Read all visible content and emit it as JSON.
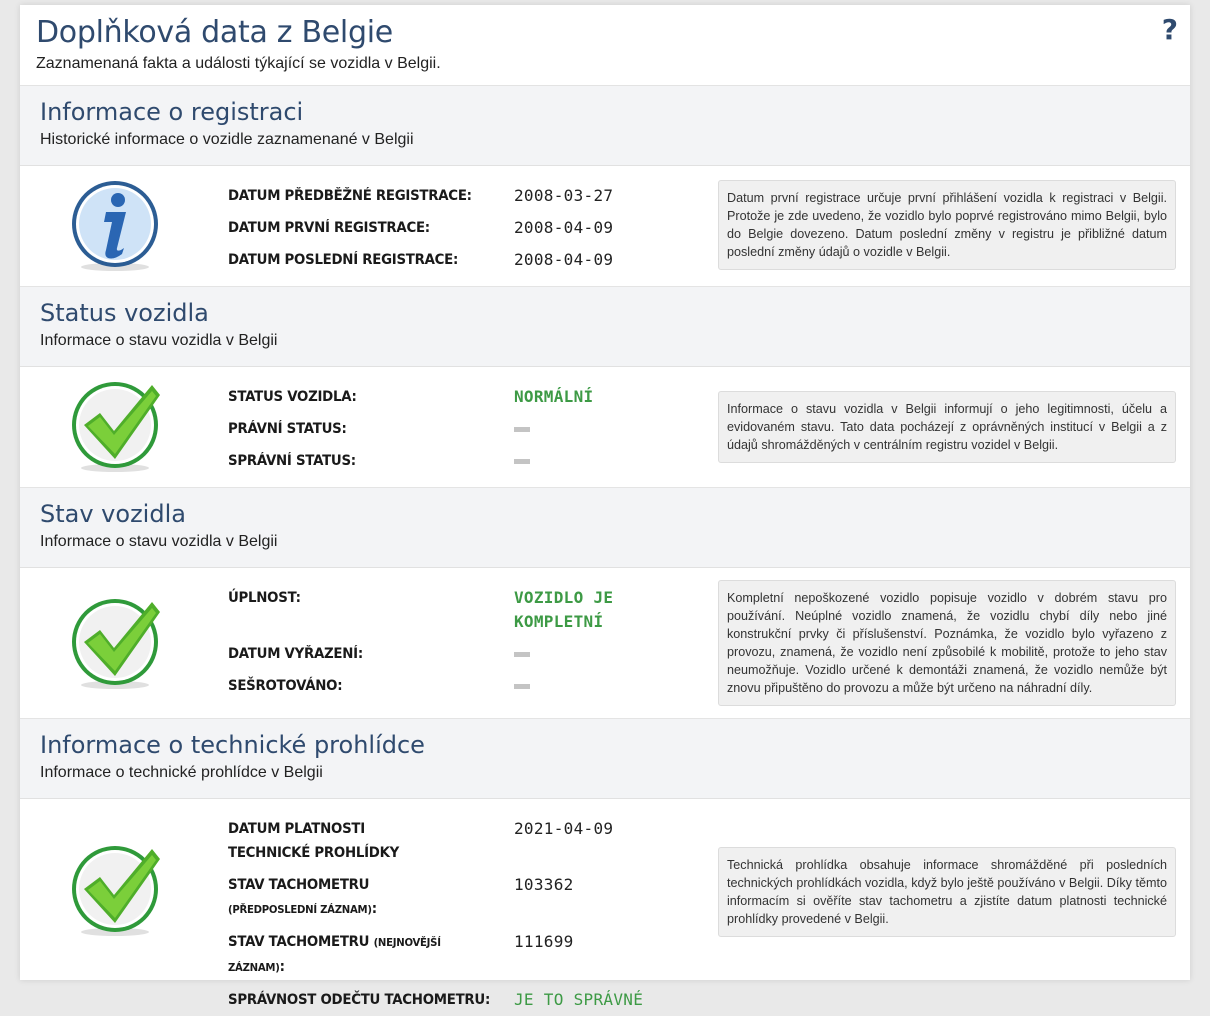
{
  "header": {
    "title": "Doplňková data z Belgie",
    "subtitle": "Zaznamenaná fakta a události týkající se vozidla v Belgii.",
    "help": "?"
  },
  "sections": [
    {
      "title": "Informace o registraci",
      "subtitle": "Historické informace o vozidle zaznamenané v Belgii",
      "icon": "info-icon",
      "fields": [
        {
          "label": "DATUM PŘEDBĚŽNÉ REGISTRACE:",
          "value": "2008-03-27"
        },
        {
          "label": "DATUM PRVNÍ REGISTRACE:",
          "value": "2008-04-09"
        },
        {
          "label": "DATUM POSLEDNÍ REGISTRACE:",
          "value": "2008-04-09"
        }
      ],
      "info": "Datum první registrace určuje první přihlášení vozidla k registraci v Belgii. Protože je zde uvedeno, že vozidlo bylo poprvé registrováno mimo Belgii, bylo do Belgie dovezeno. Datum poslední změny v registru je přibližné datum poslední změny údajů o vozidle v Belgii."
    },
    {
      "title": "Status vozidla",
      "subtitle": "Informace o stavu vozidla v Belgii",
      "icon": "checkmark-icon",
      "fields": [
        {
          "label": "STATUS VOZIDLA:",
          "value": "NORMÁLNÍ"
        },
        {
          "label": "PRÁVNÍ STATUS:",
          "value": ""
        },
        {
          "label": "SPRÁVNÍ STATUS:",
          "value": ""
        }
      ],
      "info": "Informace o stavu vozidla v Belgii informují o jeho legitimnosti, účelu a evidovaném stavu. Tato data pocházejí z oprávněných institucí v Belgii a z údajů shromážděných v centrálním registru vozidel v Belgii."
    },
    {
      "title": "Stav vozidla",
      "subtitle": "Informace o stavu vozidla v Belgii",
      "icon": "checkmark-icon",
      "fields": [
        {
          "label": "ÚPLNOST:",
          "value": "VOZIDLO JE KOMPLETNÍ"
        },
        {
          "label": "DATUM VYŘAZENÍ:",
          "value": ""
        },
        {
          "label": "SEŠROTOVÁNO:",
          "value": ""
        }
      ],
      "info": "Kompletní nepoškozené vozidlo popisuje vozidlo v dobrém stavu pro používání. Neúplné vozidlo znamená, že vozidlu chybí díly nebo jiné konstrukční prvky či příslušenství. Poznámka, že vozidlo bylo vyřazeno z provozu, znamená, že vozidlo není způsobilé k mobilitě, protože to jeho stav neumožňuje. Vozidlo určené k demontáži znamená, že vozidlo nemůže být znovu připuštěno do provozu a může být určeno na náhradní díly."
    },
    {
      "title": "Informace o technické prohlídce",
      "subtitle": "Informace o technické prohlídce v Belgii",
      "icon": "checkmark-icon",
      "fields": [
        {
          "label": "DATUM PLATNOSTI TECHNICKÉ PROHLÍDKY",
          "value": "2021-04-09"
        },
        {
          "label": "STAV TACHOMETRU",
          "label_note": "(PŘEDPOSLEDNÍ ZÁZNAM)",
          "label_suffix": ":",
          "value": "103362"
        },
        {
          "label": "STAV TACHOMETRU",
          "label_note": "(NEJNOVĚJŠÍ ZÁZNAM)",
          "label_suffix": ":",
          "value": "111699"
        },
        {
          "label": "SPRÁVNOST ODEČTU TACHOMETRU:",
          "value": "JE TO SPRÁVNÉ"
        }
      ],
      "info": "Technická prohlídka obsahuje informace shromážděné při posledních technických prohlídkách vozidla, když bylo ještě používáno v Belgii. Díky těmto informacím si ověříte stav tachometru a zjistíte datum platnosti technické prohlídky provedené v Belgii."
    }
  ],
  "colors": {
    "title": "#2f4a6e",
    "ok_green": "#3d9a45",
    "section_bg": "#f3f4f6",
    "info_box_bg": "#f0f0f0"
  }
}
